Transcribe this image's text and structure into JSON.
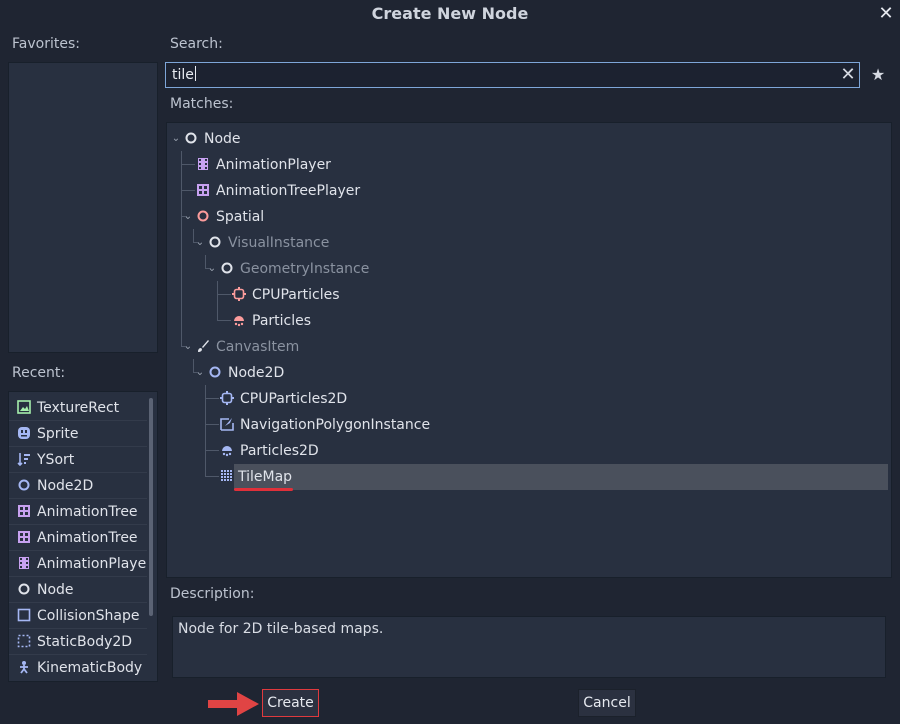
{
  "dialog": {
    "title": "Create New Node"
  },
  "favorites": {
    "label": "Favorites:"
  },
  "search": {
    "label": "Search:",
    "value": "tile"
  },
  "matches": {
    "label": "Matches:",
    "items": [
      {
        "label": "Node",
        "icon": "node-circle-icon"
      },
      {
        "label": "AnimationPlayer",
        "icon": "animation-player-icon"
      },
      {
        "label": "AnimationTreePlayer",
        "icon": "animation-tree-player-icon"
      },
      {
        "label": "Spatial",
        "icon": "spatial-circle-icon"
      },
      {
        "label": "VisualInstance",
        "icon": "node-circle-icon"
      },
      {
        "label": "GeometryInstance",
        "icon": "node-circle-icon"
      },
      {
        "label": "CPUParticles",
        "icon": "cpu-particles-icon"
      },
      {
        "label": "Particles",
        "icon": "particles-icon"
      },
      {
        "label": "CanvasItem",
        "icon": "brush-icon"
      },
      {
        "label": "Node2D",
        "icon": "node2d-circle-icon"
      },
      {
        "label": "CPUParticles2D",
        "icon": "cpu-particles-2d-icon"
      },
      {
        "label": "NavigationPolygonInstance",
        "icon": "navigation-polygon-icon"
      },
      {
        "label": "Particles2D",
        "icon": "particles-2d-icon"
      },
      {
        "label": "TileMap",
        "icon": "tilemap-grid-icon"
      }
    ]
  },
  "recent": {
    "label": "Recent:",
    "items": [
      {
        "label": "TextureRect",
        "icon": "texture-rect-icon"
      },
      {
        "label": "Sprite",
        "icon": "sprite-icon"
      },
      {
        "label": "YSort",
        "icon": "ysort-icon"
      },
      {
        "label": "Node2D",
        "icon": "node2d-circle-icon"
      },
      {
        "label": "AnimationTree",
        "icon": "animation-tree-icon"
      },
      {
        "label": "AnimationTree",
        "icon": "animation-tree-icon"
      },
      {
        "label": "AnimationPlaye",
        "icon": "animation-player-icon"
      },
      {
        "label": "Node",
        "icon": "node-circle-icon"
      },
      {
        "label": "CollisionShape",
        "icon": "collision-shape-icon"
      },
      {
        "label": "StaticBody2D",
        "icon": "static-body-2d-icon"
      },
      {
        "label": "KinematicBody",
        "icon": "kinematic-body-icon"
      }
    ]
  },
  "description": {
    "label": "Description:",
    "text": "Node for 2D tile-based maps."
  },
  "buttons": {
    "create": "Create",
    "cancel": "Cancel"
  },
  "colors": {
    "accent": "#7ea6d8",
    "highlight_red": "#e0303a",
    "node_2d_blue": "#a5b7f3",
    "spatial_red": "#fc9c9c",
    "animation_purple": "#c7a1f0",
    "control_green": "#a5efac"
  }
}
